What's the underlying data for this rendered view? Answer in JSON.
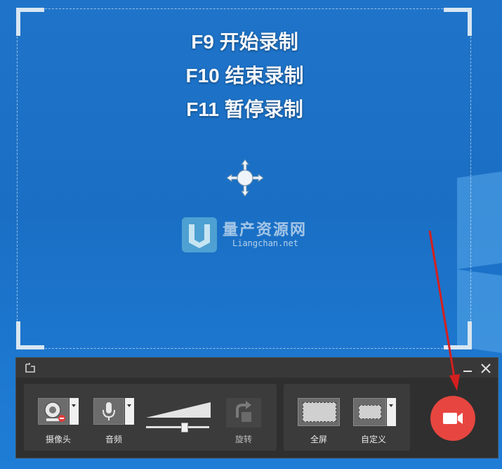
{
  "capture_region": {
    "hotkeys": [
      "F9 开始录制",
      "F10 结束录制",
      "F11 暂停录制"
    ]
  },
  "watermark": {
    "title": "量产资源网",
    "subtitle": "Liangchan.net"
  },
  "toolbar": {
    "camera": {
      "label": "摄像头",
      "icon": "webcam-icon"
    },
    "audio": {
      "label": "音频",
      "icon": "microphone-icon"
    },
    "volume": {
      "level": 0.62
    },
    "rotate": {
      "label": "旋转",
      "icon": "rotate-icon",
      "enabled": false
    },
    "fullscreen": {
      "label": "全屏"
    },
    "custom": {
      "label": "自定义"
    },
    "record": {
      "icon": "video-camera-icon",
      "color": "#e6463f"
    }
  },
  "colors": {
    "desktop": "#1f74c9",
    "annotation_arrow": "#d41f1f",
    "toolbar_bg": "#2f2f2f"
  }
}
